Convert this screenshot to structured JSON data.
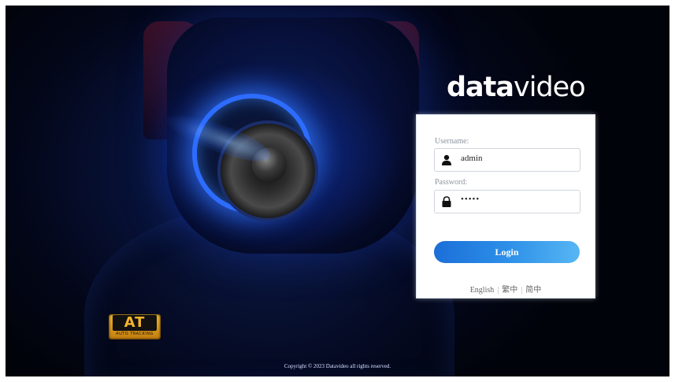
{
  "brand": {
    "logo_bold": "data",
    "logo_light": "video"
  },
  "login": {
    "username_label": "Username:",
    "username_value": "admin",
    "password_label": "Password:",
    "password_value": "•••••",
    "login_button": "Login",
    "languages": [
      "English",
      "繁中",
      "简中"
    ],
    "lang_separator": "|"
  },
  "badge": {
    "big_text": "AT",
    "small_text": "AUTO TRACKING"
  },
  "footer": {
    "copyright": "Copyright © 2023 Datavideo all rights reserved."
  },
  "icons": {
    "username": "user-icon",
    "password": "lock-icon"
  },
  "colors": {
    "button_start": "#1b6fd8",
    "button_end": "#57b6f3",
    "badge_gold": "#f1b52a"
  }
}
